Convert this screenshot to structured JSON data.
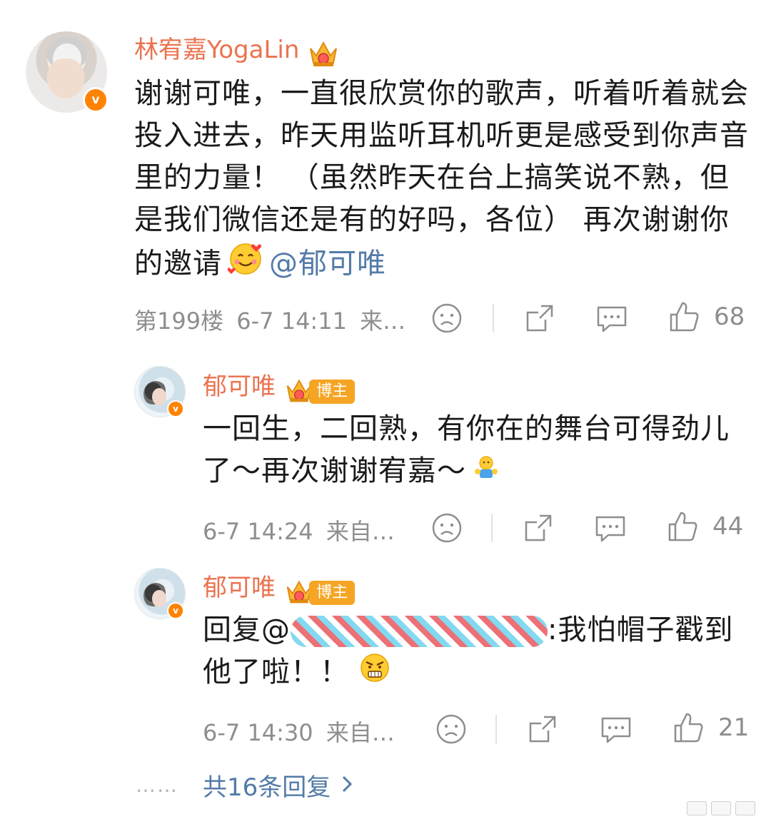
{
  "main_comment": {
    "username": "林宥嘉YogaLin",
    "text": "谢谢可唯，一直很欣赏你的歌声，听着听着就会投入进去，昨天用监听耳机听更是感受到你声音里的力量！ （虽然昨天在台上搞笑说不熟，但是我们微信还是有的好吗，各位） 再次谢谢你的邀请",
    "mention": "@郁可唯",
    "floor": "第199楼",
    "timestamp": "6-7 14:11",
    "source": "来…",
    "likes": "68"
  },
  "replies": [
    {
      "username": "郁可唯",
      "tag": "博主",
      "text": "一回生，二回熟，有你在的舞台可得劲儿了～再次谢谢宥嘉～",
      "timestamp": "6-7 14:24",
      "source": "来自…",
      "likes": "44"
    },
    {
      "username": "郁可唯",
      "tag": "博主",
      "prefix": "回复@",
      "suffix": ":我怕帽子戳到他了啦！！",
      "timestamp": "6-7 14:30",
      "source": "来自…",
      "likes": "21"
    }
  ],
  "more_replies": {
    "dots": "……",
    "label": "共16条回复"
  },
  "icons": {
    "verified": "verified-v-icon",
    "crown": "crown-badge-icon",
    "dislike": "sad-face-icon",
    "share": "share-icon",
    "comment": "comment-icon",
    "like": "thumbs-up-icon",
    "chevron": "chevron-right-icon"
  },
  "colors": {
    "username": "#eb7350",
    "mention": "#537ba8",
    "meta": "#8e8e8e",
    "verified": "#ff8200",
    "bozhu_tag": "#f5a523"
  }
}
